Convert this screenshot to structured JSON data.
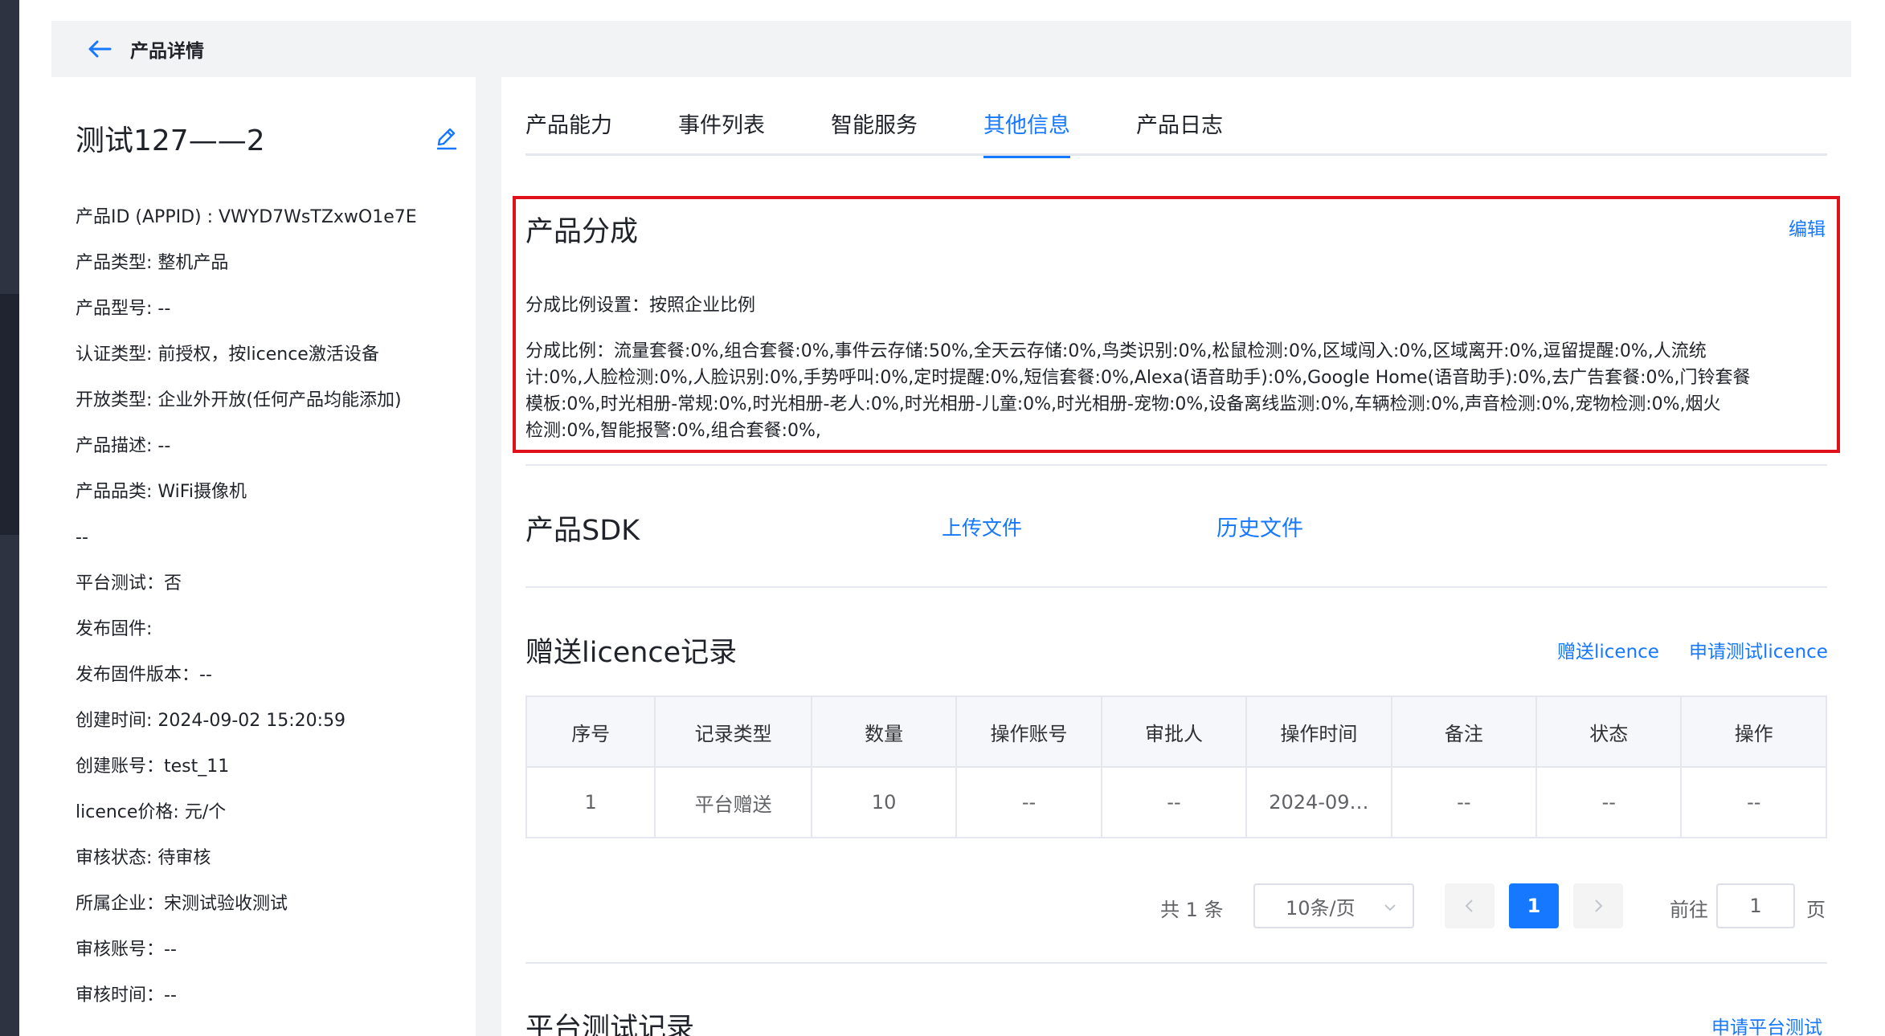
{
  "header": {
    "title": "产品详情"
  },
  "product": {
    "name": "测试127——2",
    "info": [
      "产品ID (APPID) : VWYD7WsTZxwO1e7E",
      "产品类型: 整机产品",
      "产品型号: --",
      "认证类型: 前授权，按licence激活设备",
      "开放类型: 企业外开放(任何产品均能添加)",
      "产品描述: --",
      "产品品类: WiFi摄像机",
      "--",
      "平台测试：否",
      "发布固件:",
      "发布固件版本：--",
      "创建时间: 2024-09-02 15:20:59",
      "创建账号：test_11",
      "licence价格: 元/个",
      "审核状态: 待审核",
      "所属企业：宋测试验收测试",
      "审核账号：--",
      "审核时间：--"
    ]
  },
  "tabs": [
    {
      "label": "产品能力"
    },
    {
      "label": "事件列表"
    },
    {
      "label": "智能服务"
    },
    {
      "label": "其他信息"
    },
    {
      "label": "产品日志"
    }
  ],
  "revenue": {
    "title": "产品分成",
    "edit_label": "编辑",
    "setting": "分成比例设置：按照企业比例",
    "ratio_line1": "分成比例：流量套餐:0%,组合套餐:0%,事件云存储:50%,全天云存储:0%,鸟类识别:0%,松鼠检测:0%,区域闯入:0%,区域离开:0%,逗留提醒:0%,人流统",
    "ratio_line2": "计:0%,人脸检测:0%,人脸识别:0%,手势呼叫:0%,定时提醒:0%,短信套餐:0%,Alexa(语音助手):0%,Google Home(语音助手):0%,去广告套餐:0%,门铃套餐",
    "ratio_line3": "模板:0%,时光相册-常规:0%,时光相册-老人:0%,时光相册-儿童:0%,时光相册-宠物:0%,设备离线监测:0%,车辆检测:0%,声音检测:0%,宠物检测:0%,烟火",
    "ratio_line4": "检测:0%,智能报警:0%,组合套餐:0%,"
  },
  "sdk": {
    "title": "产品SDK",
    "upload_label": "上传文件",
    "history_label": "历史文件"
  },
  "licence": {
    "title": "赠送licence记录",
    "give_label": "赠送licence",
    "apply_label": "申请测试licence",
    "columns": [
      "序号",
      "记录类型",
      "数量",
      "操作账号",
      "审批人",
      "操作时间",
      "备注",
      "状态",
      "操作"
    ],
    "rows": [
      [
        "1",
        "平台赠送",
        "10",
        "--",
        "--",
        "2024-09…",
        "--",
        "--",
        "--"
      ]
    ]
  },
  "pagination": {
    "total": "共 1 条",
    "page_size": "10条/页",
    "current": "1",
    "goto_label": "前往",
    "goto_value": "1",
    "page_unit": "页"
  },
  "platform_test": {
    "title": "平台测试记录",
    "apply_label": "申请平台测试"
  },
  "colors": {
    "accent": "#1677ff",
    "highlight": "#e0111d"
  }
}
